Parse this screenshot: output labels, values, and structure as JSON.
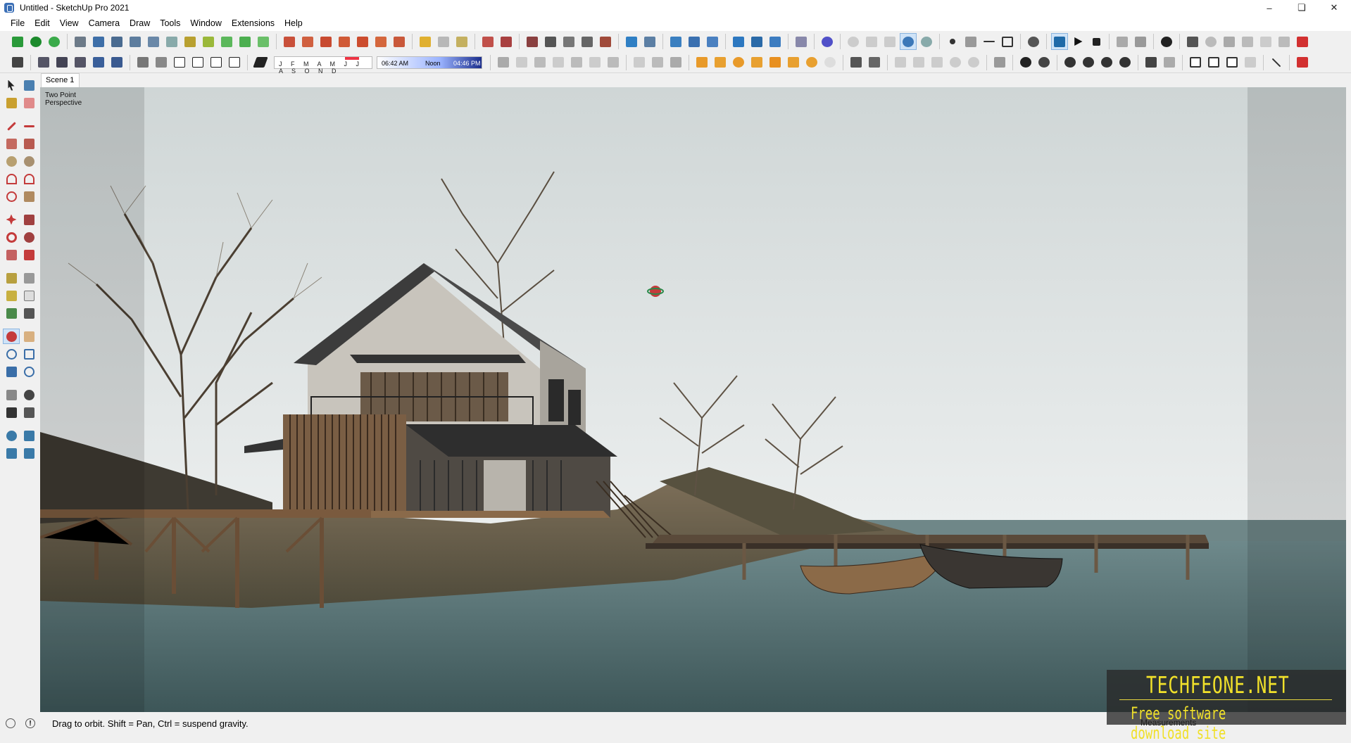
{
  "window": {
    "title": "Untitled - SketchUp Pro 2021",
    "controls": [
      "minimize-icon",
      "restore-icon",
      "close-icon"
    ]
  },
  "menubar": {
    "items": [
      "File",
      "Edit",
      "View",
      "Camera",
      "Draw",
      "Tools",
      "Window",
      "Extensions",
      "Help"
    ]
  },
  "shadows": {
    "months": "J F M A M J J A S O N D",
    "time_start": "06:42 AM",
    "time_mid": "Noon",
    "time_end": "04:46 PM"
  },
  "scenes": {
    "tabs": [
      "Scene 1"
    ]
  },
  "viewport": {
    "view_label_line1": "Two Point",
    "view_label_line2": "Perspective"
  },
  "status": {
    "hint": "Drag to orbit. Shift = Pan, Ctrl = suspend gravity.",
    "measurements_label": "Measurements",
    "measurements_value": ""
  },
  "watermark": {
    "brand": "TECHFEONE.NET",
    "tagline": "Free software download site"
  },
  "colors": {
    "accent_red": "#d23030",
    "active_tool_bg": "#cfe3f7",
    "watermark_yellow": "#f0e02a"
  },
  "active_tool": "orbit-tool"
}
